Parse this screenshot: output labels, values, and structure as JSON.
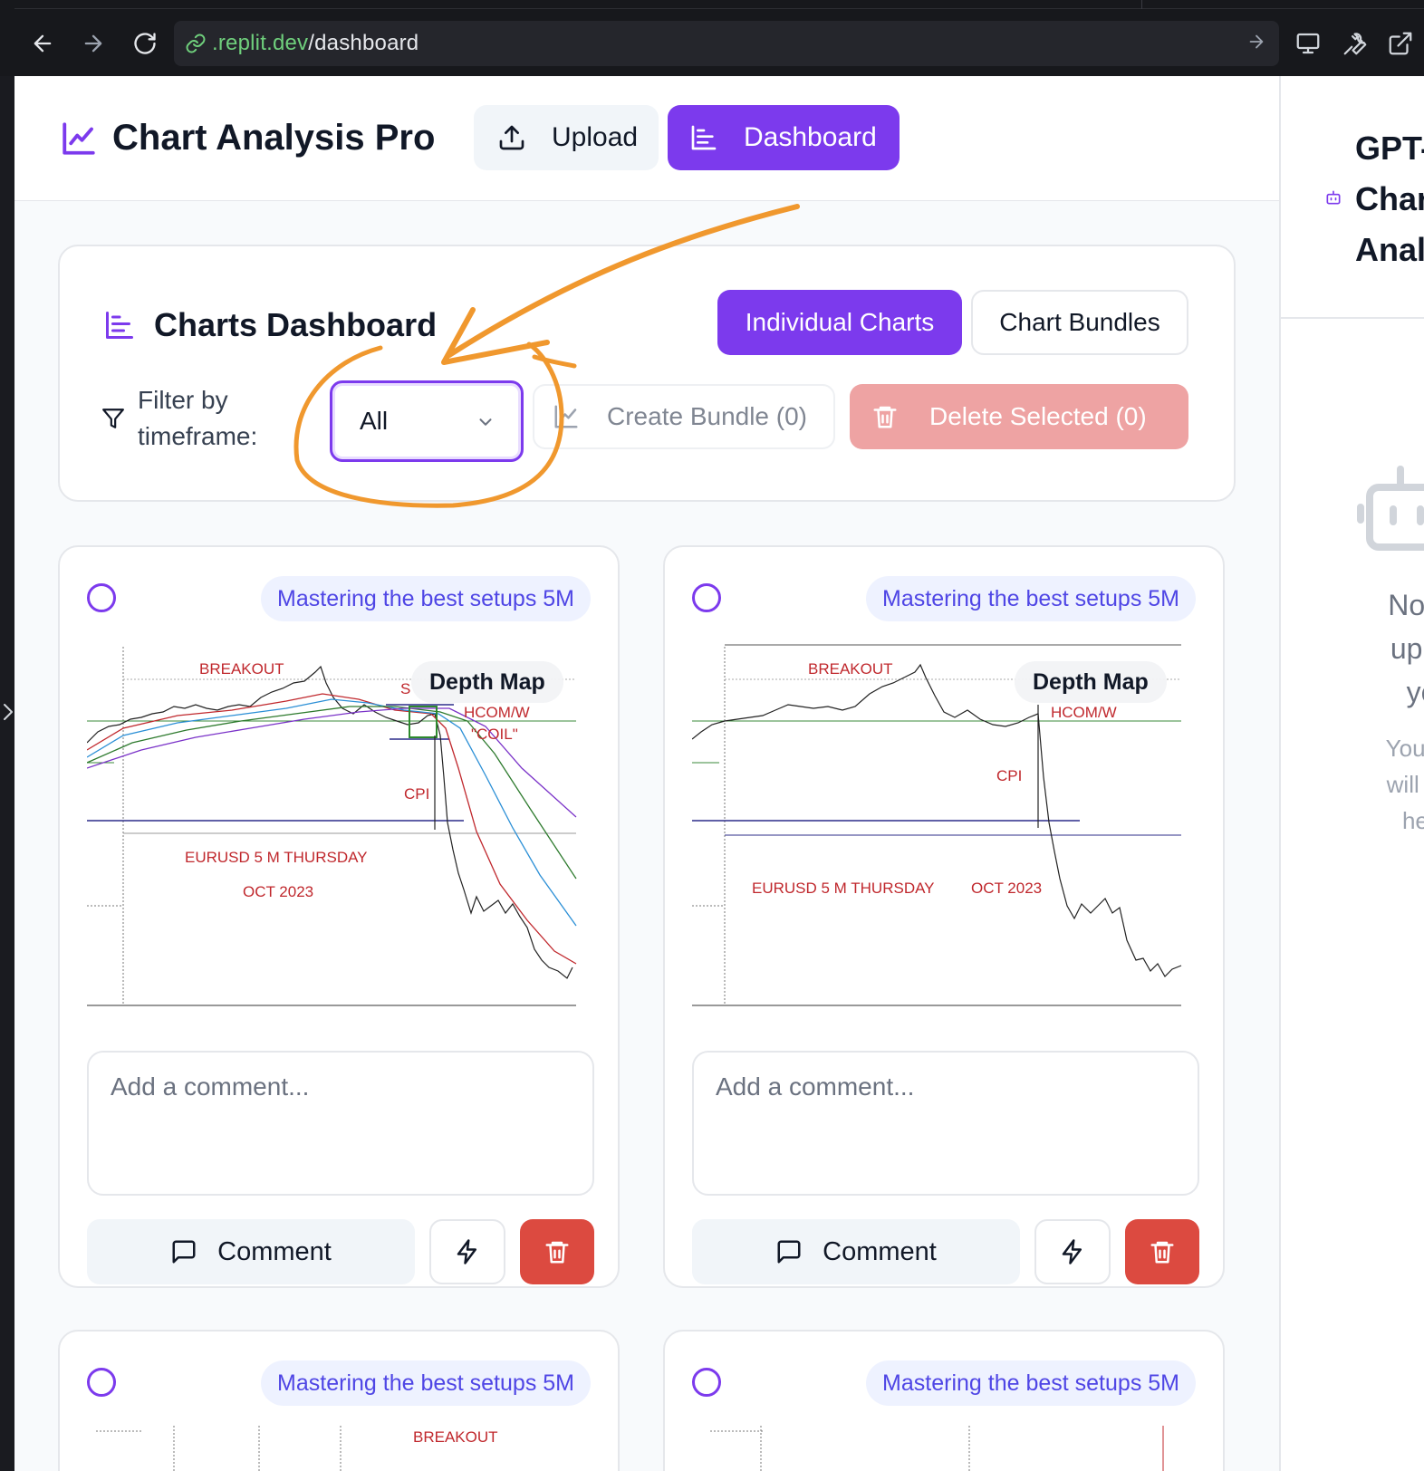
{
  "browser": {
    "url_host": ".replit.dev",
    "url_path": "/dashboard"
  },
  "header": {
    "app_title": "Chart Analysis Pro",
    "nav": [
      {
        "label": "Upload",
        "icon": "upload-icon"
      },
      {
        "label": "Dashboard",
        "icon": "bar-chart-icon",
        "active": true
      }
    ]
  },
  "dashboard": {
    "title": "Charts Dashboard",
    "view_tabs": [
      {
        "label": "Individual Charts",
        "active": true
      },
      {
        "label": "Chart Bundles",
        "active": false
      }
    ],
    "filter_label": "Filter by timeframe:",
    "filter_value": "All",
    "create_bundle_label": "Create Bundle (0)",
    "delete_selected_label": "Delete Selected (0)"
  },
  "cards": [
    {
      "badge": "Mastering the best setups 5M",
      "depth_label": "Depth Map",
      "chart_labels": {
        "breakout": "BREAKOUT",
        "s": "S",
        "hcom": "HCOM/W",
        "coil": "\"COIL\"",
        "cpi": "CPI",
        "caption1": "EURUSD 5 M THURSDAY",
        "caption2": "OCT 2023"
      },
      "comment_placeholder": "Add a comment...",
      "comment_button": "Comment"
    },
    {
      "badge": "Mastering the best setups 5M",
      "depth_label": "Depth Map",
      "chart_labels": {
        "breakout": "BREAKOUT",
        "hcom": "HCOM/W",
        "cpi": "CPI",
        "caption1": "EURUSD 5 M THURSDAY",
        "caption2": "OCT 2023"
      },
      "comment_placeholder": "Add a comment...",
      "comment_button": "Comment"
    },
    {
      "badge": "Mastering the best setups 5M",
      "chart_labels": {
        "breakout": "BREAKOUT"
      }
    },
    {
      "badge": "Mastering the best setups 5M"
    }
  ],
  "sidebar": {
    "title_lines": [
      "GPT-",
      "Char",
      "Analy"
    ],
    "empty_lines": [
      "No ch",
      "uploa",
      "yet"
    ],
    "sub_lines": [
      "Your an",
      "will app",
      "here"
    ]
  },
  "colors": {
    "accent": "#7c3aed",
    "danger": "#dc4a40",
    "danger_disabled": "#eea3a3",
    "annotation": "#f0982e",
    "chart_label": "#c0282d"
  }
}
